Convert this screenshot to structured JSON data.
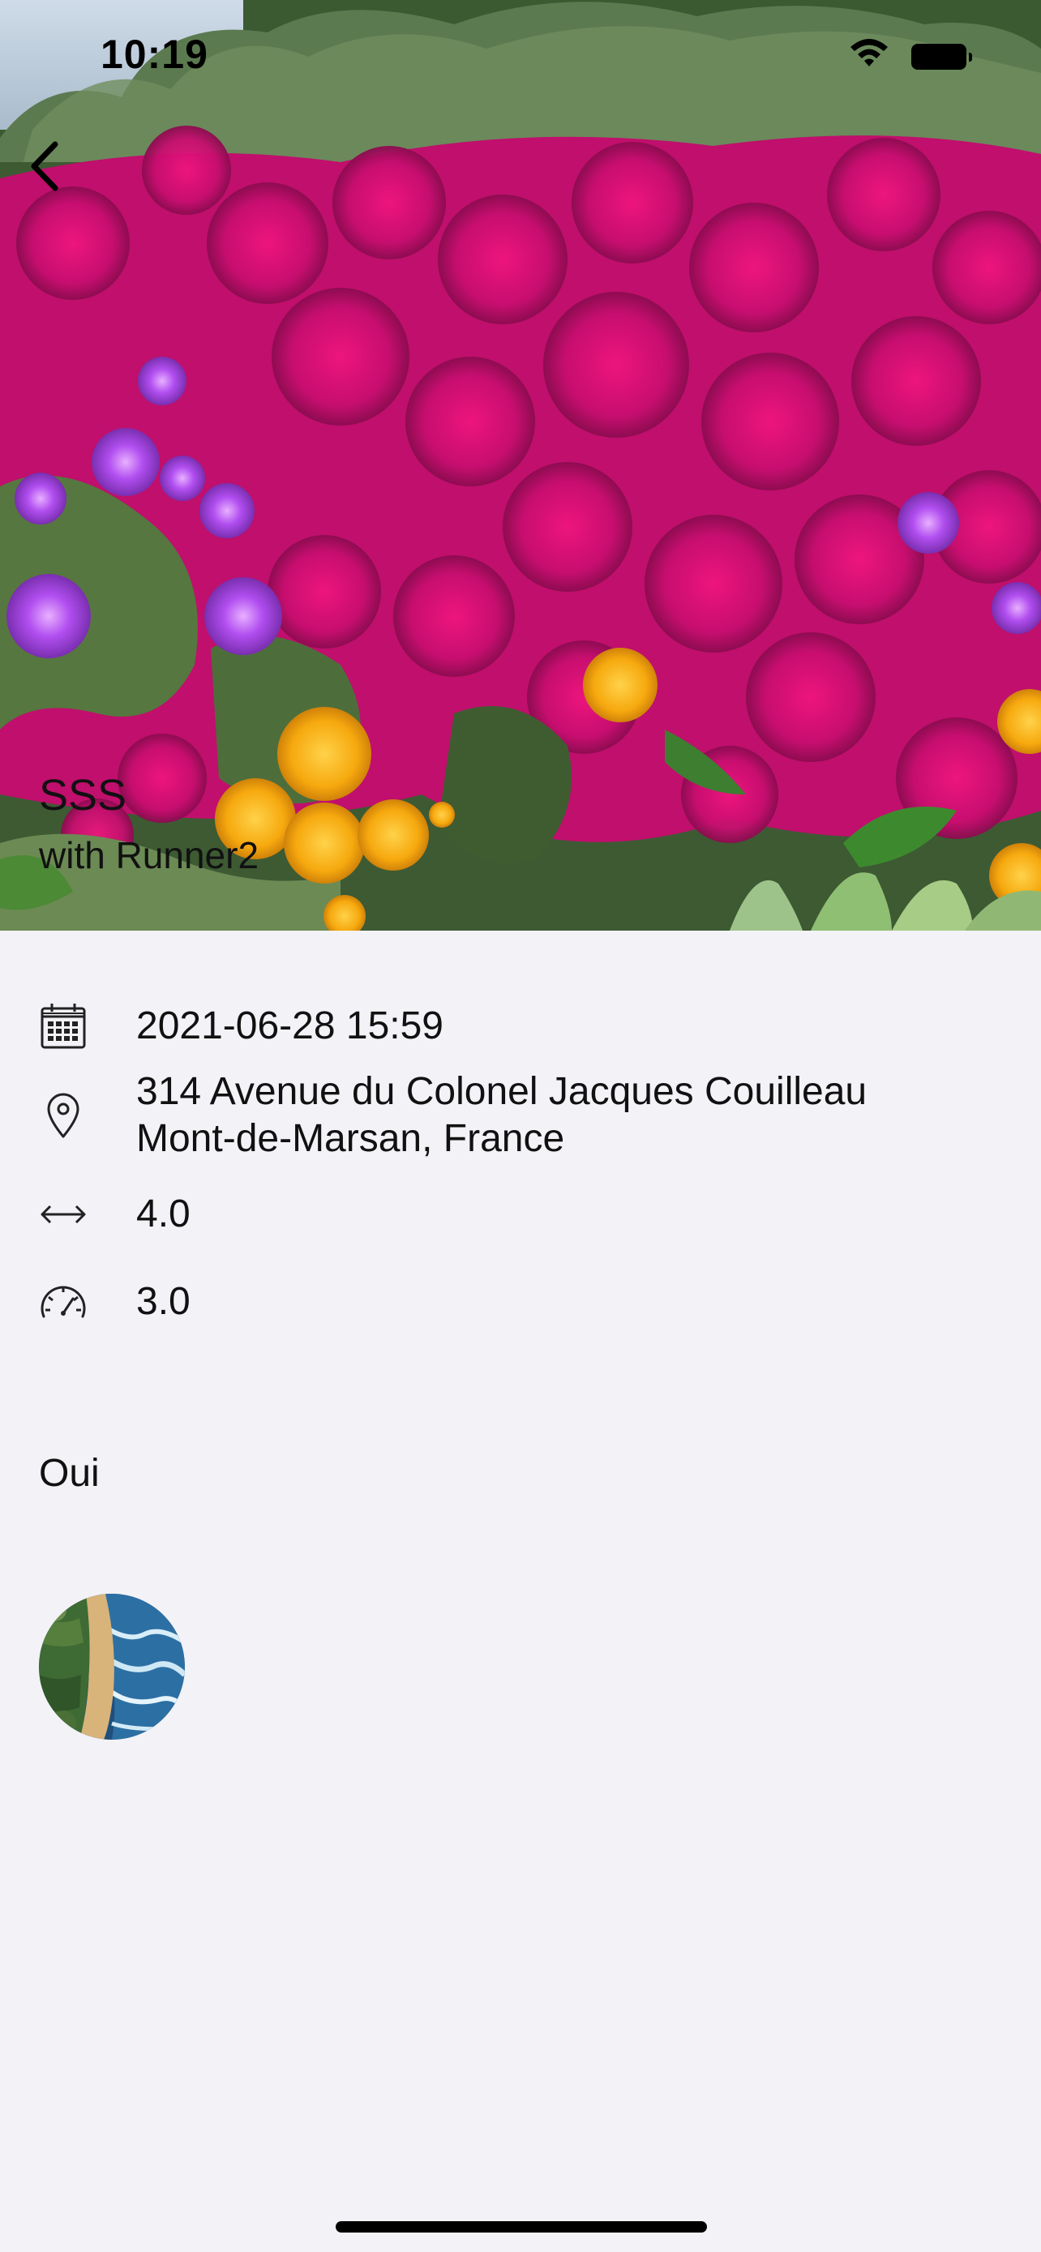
{
  "status_bar": {
    "time": "10:19",
    "wifi_icon": "wifi-icon",
    "battery_icon": "battery-icon"
  },
  "hero": {
    "back_icon": "chevron-left-icon",
    "photo_description": "flowers",
    "title": "SSS",
    "subtitle": "with Runner2"
  },
  "details": {
    "date": {
      "icon": "calendar-icon",
      "text": "2021-06-28 15:59"
    },
    "location": {
      "icon": "map-pin-icon",
      "line1": "314 Avenue du Colonel Jacques Couilleau",
      "line2": "Mont-de-Marsan, France"
    },
    "distance": {
      "icon": "horizontal-arrows-icon",
      "text": "4.0"
    },
    "speed": {
      "icon": "speedometer-icon",
      "text": "3.0"
    }
  },
  "answer": "Oui",
  "avatar": {
    "icon": "beach-avatar"
  },
  "colors": {
    "background": "#f2f2f7",
    "flower_magenta": "#d8127e",
    "flower_purple": "#a13de8",
    "flower_yellow": "#f6b511",
    "foliage": "#4b6b3a",
    "text": "#111111"
  }
}
